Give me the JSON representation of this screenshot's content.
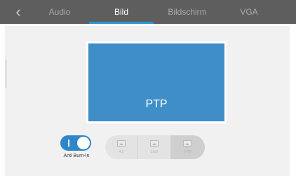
{
  "nav": {
    "back_icon": "chevron-left-icon",
    "tabs": [
      {
        "label": "Audio",
        "active": false
      },
      {
        "label": "Bild",
        "active": true
      },
      {
        "label": "Bildschirm",
        "active": false
      },
      {
        "label": "VGA",
        "active": false
      }
    ]
  },
  "preview": {
    "label": "PTP"
  },
  "anti_burn_in": {
    "label": "Anti Burn-In",
    "on": true
  },
  "aspect": {
    "options": [
      {
        "label": "4:3",
        "icon": "image-icon"
      },
      {
        "label": "16:9",
        "icon": "image-icon"
      },
      {
        "label": "PTP",
        "icon": "image-icon"
      }
    ],
    "selected": "PTP"
  },
  "colors": {
    "accent": "#2f86c8",
    "topbar": "#5e5e5e",
    "preview": "#3f8ec8",
    "panel": "#f1f1f1"
  }
}
